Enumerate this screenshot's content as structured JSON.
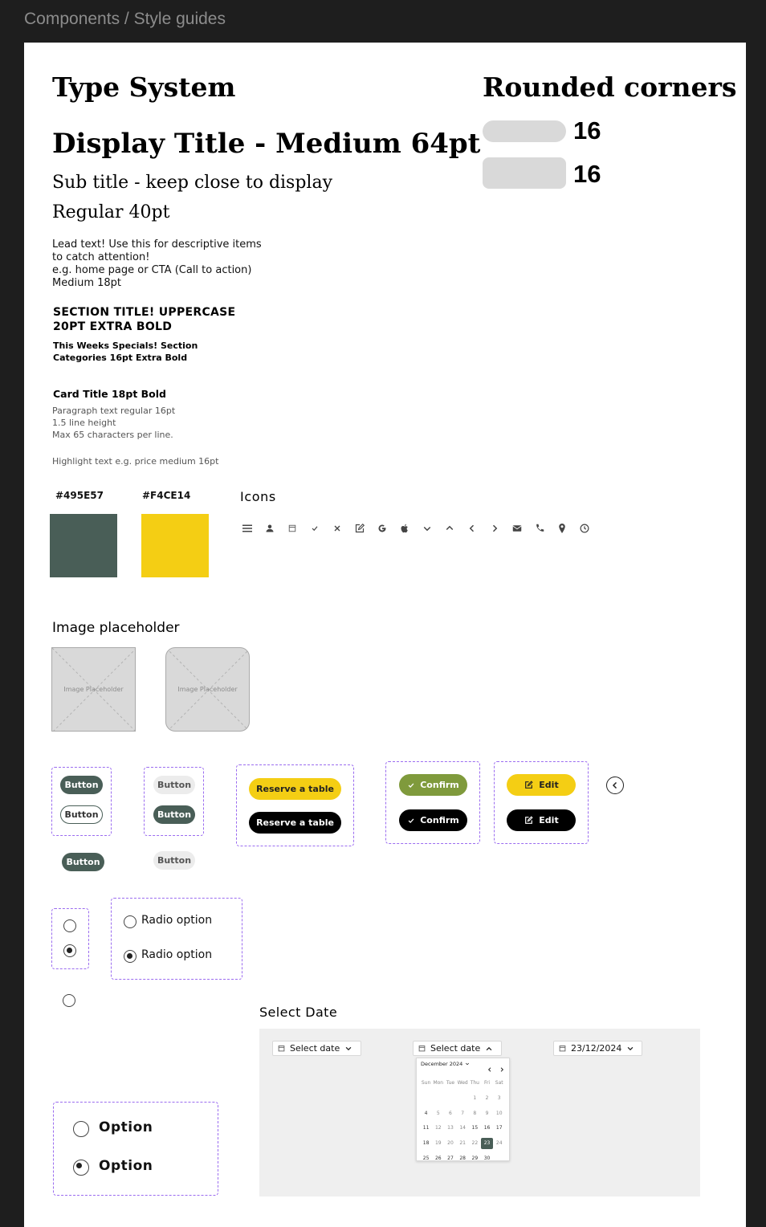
{
  "breadcrumb": "Components / Style guides",
  "type_system": {
    "heading": "Type System",
    "display": "Display Title - Medium 64pt",
    "subtitle": "Sub title - keep close to display",
    "regular": "Regular 40pt",
    "lead": "Lead text! Use this for descriptive items\nto catch attention!\ne.g. home page or CTA (Call to action)\nMedium 18pt",
    "section": "SECTION TITLE! UPPERCASE\n20PT EXTRA BOLD",
    "categories": "This Weeks Specials! Section\nCategories 16pt Extra Bold",
    "card_title": "Card Title 18pt Bold",
    "paragraph": "Paragraph text regular 16pt\n1.5 line height\nMax 65 characters per line.",
    "highlight": "Highlight text e.g. price medium 16pt"
  },
  "rounded_corners": {
    "heading": "Rounded corners",
    "items": [
      {
        "value": "16"
      },
      {
        "value": "16"
      }
    ]
  },
  "colors": {
    "swatches": [
      {
        "label": "#495E57",
        "hex": "#495e57"
      },
      {
        "label": "#F4CE14",
        "hex": "#f4ce14"
      }
    ]
  },
  "icons": {
    "heading": "Icons",
    "names": [
      "menu-icon",
      "user-icon",
      "calendar-icon",
      "check-icon",
      "close-icon",
      "edit-icon",
      "google-icon",
      "apple-icon",
      "chevron-down-icon",
      "chevron-up-icon",
      "chevron-left-icon",
      "chevron-right-icon",
      "mail-icon",
      "phone-icon",
      "location-pin-icon",
      "clock-icon"
    ]
  },
  "image_placeholder": {
    "heading": "Image placeholder",
    "label": "Image Placeholder"
  },
  "buttons": {
    "button": "Button",
    "reserve": "Reserve a table",
    "confirm": "Confirm",
    "edit": "Edit"
  },
  "radios": {
    "option_label": "Radio option",
    "large_option_label": "Option"
  },
  "date": {
    "heading": "Select Date",
    "placeholder": "Select date",
    "selected_value": "23/12/2024",
    "calendar": {
      "month": "December 2024",
      "weekdays": [
        "Sun",
        "Mon",
        "Tue",
        "Wed",
        "Thu",
        "Fri",
        "Sat"
      ],
      "weeks": [
        [
          "",
          "",
          "",
          "",
          "1",
          "2",
          "3"
        ],
        [
          "4",
          "5",
          "6",
          "7",
          "8",
          "9",
          "10"
        ],
        [
          "11",
          "12",
          "13",
          "14",
          "15",
          "16",
          "17"
        ],
        [
          "18",
          "19",
          "20",
          "21",
          "22",
          "23",
          "24"
        ],
        [
          "25",
          "26",
          "27",
          "28",
          "29",
          "30",
          ""
        ]
      ],
      "selected_day": "23"
    }
  }
}
